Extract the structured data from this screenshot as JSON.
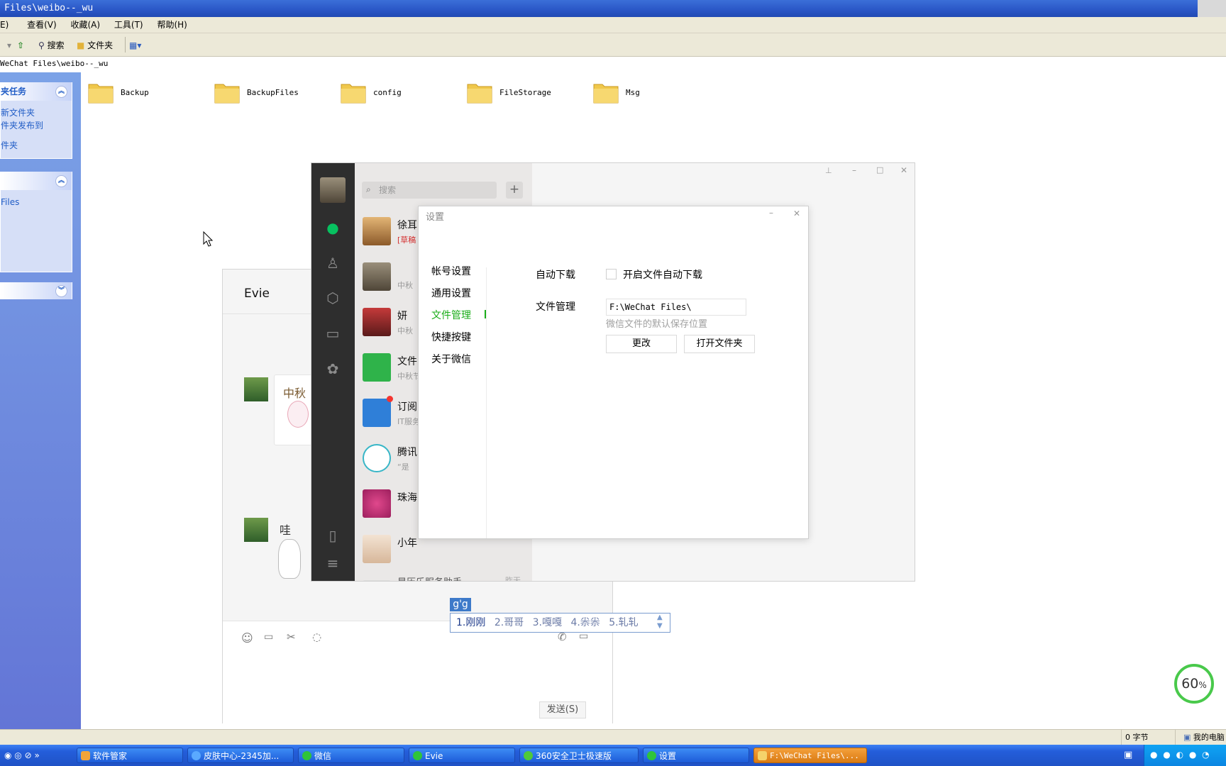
{
  "explorer": {
    "title": "Files\\weibo--_wu",
    "menu": [
      "E)",
      "查看(V)",
      "收藏(A)",
      "工具(T)",
      "帮助(H)"
    ],
    "toolbar": {
      "search": "搜索",
      "folders": "文件夹"
    },
    "address": "WeChat Files\\weibo--_wu",
    "tasks": {
      "head1": "夹任务",
      "items1": [
        "新文件夹",
        "件夹发布到",
        "件夹"
      ],
      "items2": [
        "Files"
      ]
    },
    "folders": [
      "Backup",
      "BackupFiles",
      "config",
      "FileStorage",
      "Msg"
    ],
    "status": {
      "bytes": "0 字节",
      "computer": "我的电脑"
    }
  },
  "taskbar": {
    "items": [
      "软件管家",
      "皮肤中心-2345加...",
      "微信",
      "Evie",
      "360安全卫士极速版",
      "设置",
      "F:\\WeChat Files\\..."
    ]
  },
  "chat": {
    "title": "Evie",
    "send_label": "发送(S)",
    "sticker1_text": "中秋",
    "sticker2_text": "哇"
  },
  "wechat": {
    "search_placeholder": "搜索",
    "add_label": "+",
    "conversations": [
      {
        "name": "徐耳",
        "snippet": "[草稿"
      },
      {
        "name": "",
        "snippet": "中秋"
      },
      {
        "name": "妍",
        "snippet": "中秋"
      },
      {
        "name": "文件",
        "snippet": "中秋节"
      },
      {
        "name": "订阅",
        "snippet": "IT服务"
      },
      {
        "name": "腾讯",
        "snippet": "“是"
      },
      {
        "name": "珠海",
        "snippet": ""
      },
      {
        "name": "小年",
        "snippet": ""
      },
      {
        "name": "星历乐服务助手",
        "snippet": "",
        "time": "昨天"
      }
    ]
  },
  "settings": {
    "title": "设置",
    "menu": [
      "帐号设置",
      "通用设置",
      "文件管理",
      "快捷按键",
      "关于微信"
    ],
    "active_index": 2,
    "auto_download_label": "自动下载",
    "auto_download_checkbox": "开启文件自动下载",
    "auto_download_checked": false,
    "file_mgmt_label": "文件管理",
    "file_path": "F:\\WeChat Files\\",
    "file_hint": "微信文件的默认保存位置",
    "change_btn": "更改",
    "open_btn": "打开文件夹"
  },
  "ime": {
    "composition": "g'g",
    "candidates": [
      "1.刚刚",
      "2.哥哥",
      "3.嘎嘎",
      "4.尜尜",
      "5.轧轧"
    ]
  },
  "speed": {
    "value": "60",
    "unit": "%"
  },
  "colors": {
    "wechat_green": "#1aad19",
    "xp_blue": "#245edb",
    "nav_dark": "#2e2e2e"
  }
}
